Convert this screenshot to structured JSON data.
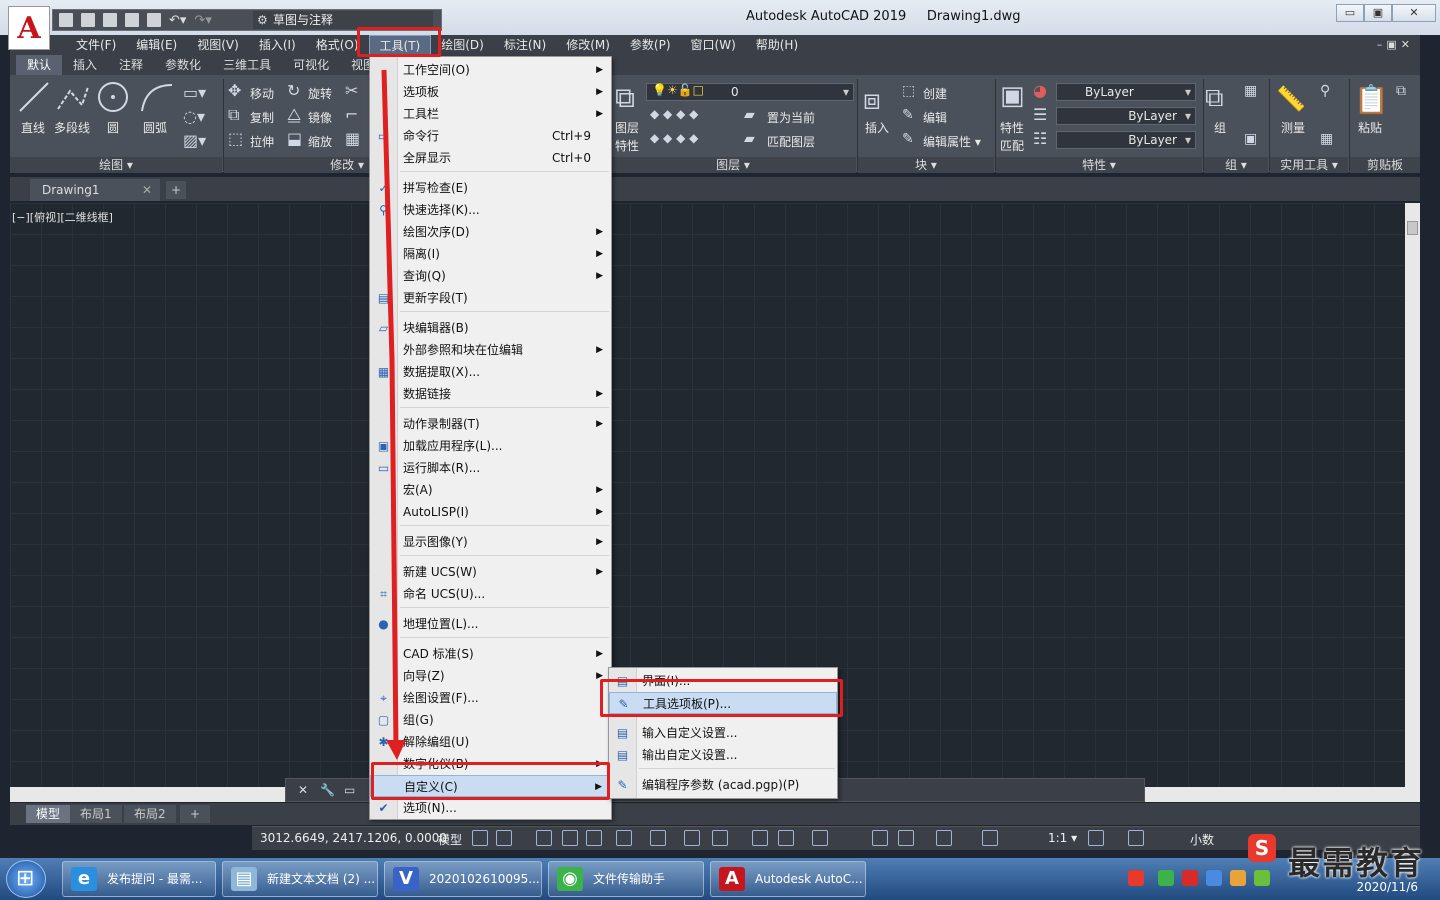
{
  "app": {
    "logo_letter": "A",
    "title": "Autodesk AutoCAD 2019",
    "document": "Drawing1.dwg",
    "workspace": "草图与注释"
  },
  "window_controls": {
    "minimize": "▭",
    "restore": "▣",
    "close": "✕"
  },
  "menubar": [
    {
      "label": "文件(F)"
    },
    {
      "label": "编辑(E)"
    },
    {
      "label": "视图(V)"
    },
    {
      "label": "插入(I)"
    },
    {
      "label": "格式(O)"
    },
    {
      "label": "工具(T)"
    },
    {
      "label": "绘图(D)"
    },
    {
      "label": "标注(N)"
    },
    {
      "label": "修改(M)"
    },
    {
      "label": "参数(P)"
    },
    {
      "label": "窗口(W)"
    },
    {
      "label": "帮助(H)"
    }
  ],
  "menubar_right": "–▣✕",
  "ribbon_tabs": [
    "默认",
    "插入",
    "注释",
    "参数化",
    "三维工具",
    "可视化",
    "视图"
  ],
  "ribbon": {
    "draw": {
      "line": "直线",
      "polyline": "多段线",
      "circle": "圆",
      "arc": "圆弧",
      "label": "绘图 ▾"
    },
    "modify": {
      "move": "移动",
      "rotate": "旋转",
      "copy": "复制",
      "mirror": "镜像",
      "stretch": "拉伸",
      "scale": "缩放",
      "label": "修改 ▾"
    },
    "layers": {
      "layer_props": "图层",
      "layer_props2": "特性",
      "current_layer": "0",
      "set_current": "置为当前",
      "match_layer": "匹配图层",
      "label": "图层 ▾"
    },
    "block": {
      "insert": "插入",
      "create": "创建",
      "edit": "编辑",
      "edit_attr": "编辑属性 ▾",
      "label": "块 ▾"
    },
    "properties": {
      "match": "特性",
      "match2": "匹配",
      "color": "ByLayer",
      "linetype": "ByLayer",
      "lineweight": "ByLayer",
      "label": "特性 ▾"
    },
    "groups": {
      "group": "组",
      "label": "组 ▾"
    },
    "utilities": {
      "measure": "测量",
      "label": "实用工具 ▾"
    },
    "clipboard": {
      "paste": "粘贴",
      "label": "剪贴板"
    }
  },
  "file_tabs": [
    {
      "label": "Drawing1",
      "close": "✕"
    }
  ],
  "file_tab_add": "+",
  "viewport_label": "[−][俯视][二维线框]",
  "tools_menu": {
    "items": [
      {
        "label": "工作空间(O)",
        "shortcut": "",
        "submenu": true,
        "icon": ""
      },
      {
        "label": "选项板",
        "shortcut": "",
        "submenu": true,
        "icon": ""
      },
      {
        "label": "工具栏",
        "shortcut": "",
        "submenu": true,
        "icon": ""
      },
      {
        "label": "命令行",
        "shortcut": "Ctrl+9",
        "submenu": false,
        "icon": "▭"
      },
      {
        "label": "全屏显示",
        "shortcut": "Ctrl+0",
        "submenu": false,
        "icon": ""
      },
      {
        "label": "拼写检查(E)",
        "shortcut": "",
        "submenu": false,
        "icon": "✓"
      },
      {
        "label": "快速选择(K)...",
        "shortcut": "",
        "submenu": false,
        "icon": "⚲"
      },
      {
        "label": "绘图次序(D)",
        "shortcut": "",
        "submenu": true,
        "icon": ""
      },
      {
        "label": "隔离(I)",
        "shortcut": "",
        "submenu": true,
        "icon": ""
      },
      {
        "label": "查询(Q)",
        "shortcut": "",
        "submenu": true,
        "icon": ""
      },
      {
        "label": "更新字段(T)",
        "shortcut": "",
        "submenu": false,
        "icon": "▤"
      },
      {
        "label": "块编辑器(B)",
        "shortcut": "",
        "submenu": false,
        "icon": "▱"
      },
      {
        "label": "外部参照和块在位编辑",
        "shortcut": "",
        "submenu": true,
        "icon": ""
      },
      {
        "label": "数据提取(X)...",
        "shortcut": "",
        "submenu": false,
        "icon": "▦"
      },
      {
        "label": "数据链接",
        "shortcut": "",
        "submenu": true,
        "icon": ""
      },
      {
        "label": "动作录制器(T)",
        "shortcut": "",
        "submenu": true,
        "icon": ""
      },
      {
        "label": "加载应用程序(L)...",
        "shortcut": "",
        "submenu": false,
        "icon": "▣"
      },
      {
        "label": "运行脚本(R)...",
        "shortcut": "",
        "submenu": false,
        "icon": "▭"
      },
      {
        "label": "宏(A)",
        "shortcut": "",
        "submenu": true,
        "icon": ""
      },
      {
        "label": "AutoLISP(I)",
        "shortcut": "",
        "submenu": true,
        "icon": ""
      },
      {
        "label": "显示图像(Y)",
        "shortcut": "",
        "submenu": true,
        "icon": ""
      },
      {
        "label": "新建 UCS(W)",
        "shortcut": "",
        "submenu": true,
        "icon": ""
      },
      {
        "label": "命名 UCS(U)...",
        "shortcut": "",
        "submenu": false,
        "icon": "⌗"
      },
      {
        "label": "地理位置(L)...",
        "shortcut": "",
        "submenu": false,
        "icon": "●"
      },
      {
        "label": "CAD 标准(S)",
        "shortcut": "",
        "submenu": true,
        "icon": ""
      },
      {
        "label": "向导(Z)",
        "shortcut": "",
        "submenu": true,
        "icon": ""
      },
      {
        "label": "绘图设置(F)...",
        "shortcut": "",
        "submenu": false,
        "icon": "⌖"
      },
      {
        "label": "组(G)",
        "shortcut": "",
        "submenu": false,
        "icon": "▢"
      },
      {
        "label": "解除编组(U)",
        "shortcut": "",
        "submenu": false,
        "icon": "✱"
      },
      {
        "label": "数字化仪(B)",
        "shortcut": "",
        "submenu": true,
        "icon": ""
      },
      {
        "label": "自定义(C)",
        "shortcut": "",
        "submenu": true,
        "icon": ""
      },
      {
        "label": "选项(N)...",
        "shortcut": "",
        "submenu": false,
        "icon": "✔"
      }
    ]
  },
  "customize_submenu": {
    "items": [
      {
        "label": "界面(I)...",
        "icon": "▤"
      },
      {
        "label": "工具选项板(P)...",
        "icon": "✎"
      },
      {
        "label": "输入自定义设置...",
        "icon": "▤"
      },
      {
        "label": "输出自定义设置...",
        "icon": "▤"
      },
      {
        "label": "编辑程序参数 (acad.pgp)(P)",
        "icon": "✎"
      }
    ]
  },
  "layout_tabs": [
    "模型",
    "布局1",
    "布局2",
    "+"
  ],
  "statusbar": {
    "coords": "3012.6649, 2417.1206, 0.0000",
    "model": "模型",
    "scale": "1:1 ▾",
    "units": "小数"
  },
  "taskbar": [
    {
      "label": "发布提问 - 最需...",
      "icon": "e",
      "color": "#2b8fe0"
    },
    {
      "label": "新建文本文档 (2) ...",
      "icon": "▤",
      "color": "#8fb8d8"
    },
    {
      "label": "2020102610095...",
      "icon": "V",
      "color": "#3a63c8"
    },
    {
      "label": "文件传输助手",
      "icon": "◉",
      "color": "#3bb24a"
    },
    {
      "label": "Autodesk AutoC...",
      "icon": "A",
      "color": "#c4161c"
    }
  ],
  "tray": {
    "date": "2020/11/6"
  },
  "watermark": {
    "logo": "S",
    "text": "最需教育"
  }
}
